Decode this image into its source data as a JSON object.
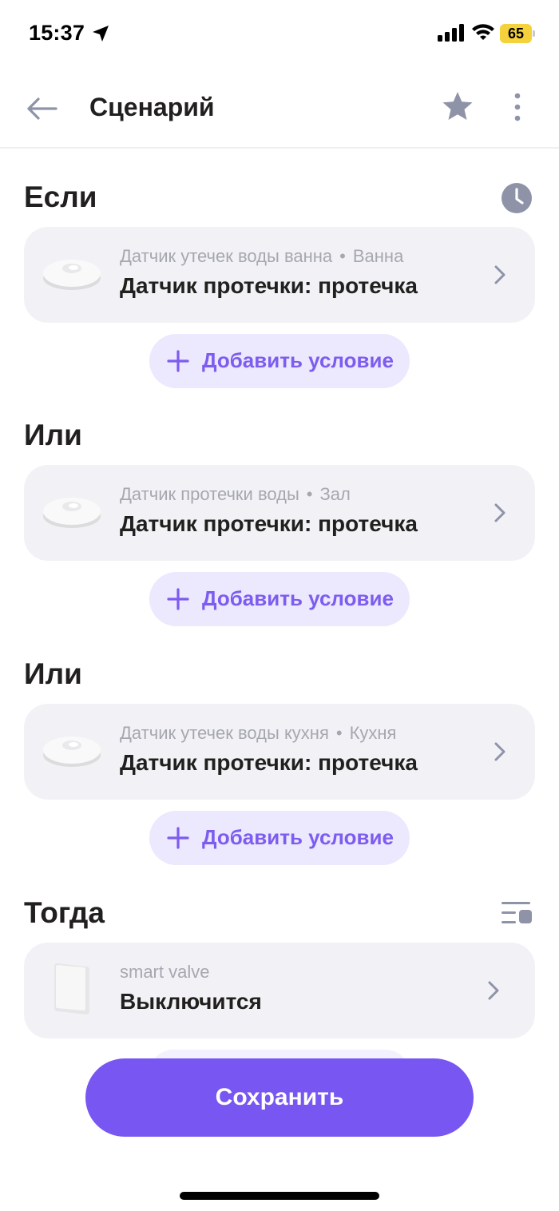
{
  "status_bar": {
    "time": "15:37",
    "battery": "65"
  },
  "header": {
    "title": "Сценарий"
  },
  "sections": {
    "if_title": "Если",
    "or1_title": "Или",
    "or2_title": "Или",
    "then_title": "Тогда"
  },
  "conditions": [
    {
      "device": "Датчик утечек воды ванна",
      "room": "Ванна",
      "event": "Датчик протечки: протечка"
    },
    {
      "device": "Датчик протечки воды",
      "room": "Зал",
      "event": "Датчик протечки: протечка"
    },
    {
      "device": "Датчик утечек воды кухня",
      "room": "Кухня",
      "event": "Датчик протечки: протечка"
    }
  ],
  "add_condition_label": "Добавить условие",
  "action": {
    "device": "smart valve",
    "event": "Выключится"
  },
  "save_label": "Сохранить",
  "separator": "•",
  "colors": {
    "accent": "#7856f2",
    "accent_light": "#ece8fd",
    "card_bg": "#f2f2f6",
    "icon_gray": "#8f93a8"
  }
}
